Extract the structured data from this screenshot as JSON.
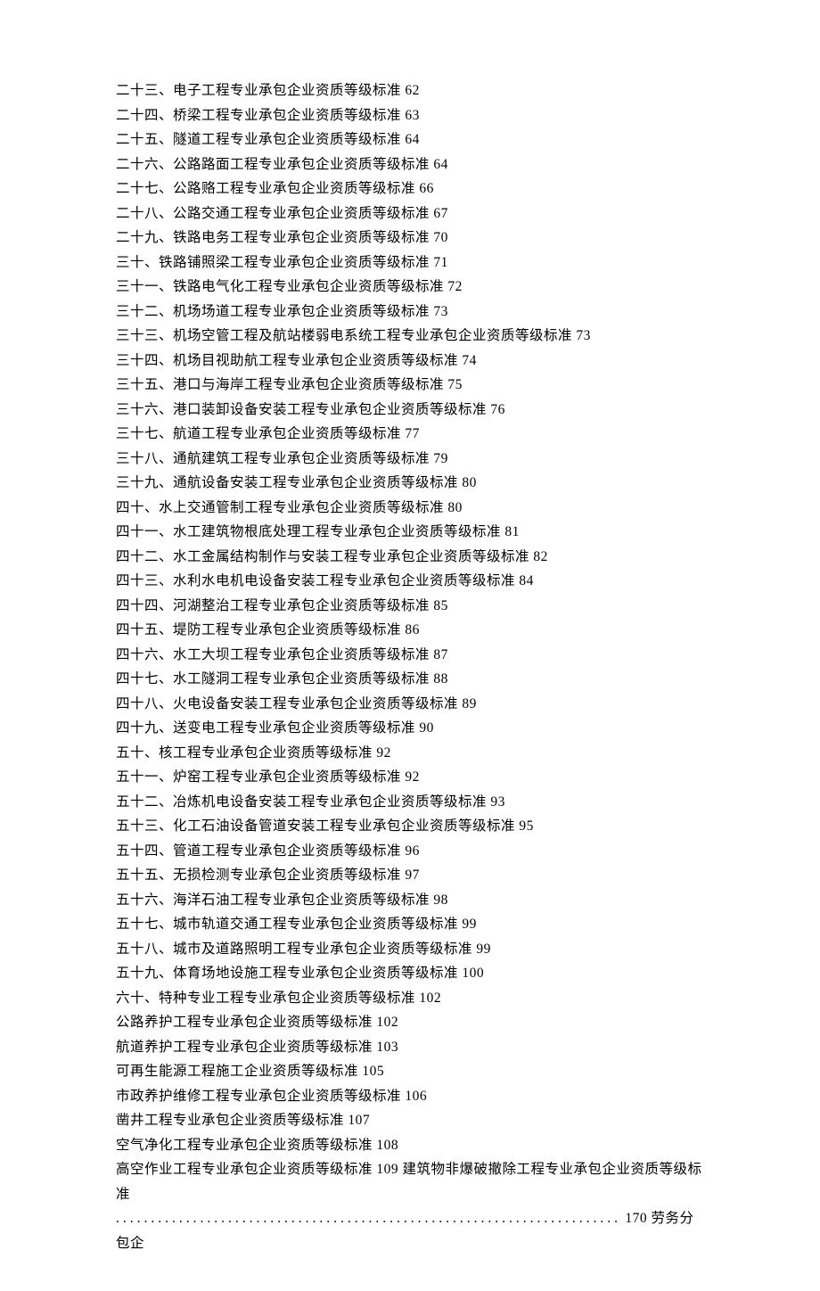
{
  "toc_lines": [
    "二十三、电子工程专业承包企业资质等级标准 62",
    "二十四、桥梁工程专业承包企业资质等级标准 63",
    "二十五、隧道工程专业承包企业资质等级标准 64",
    "二十六、公路路面工程专业承包企业资质等级标准 64",
    "二十七、公路赂工程专业承包企业资质等级标准 66",
    "二十八、公路交通工程专业承包企业资质等级标准 67",
    "二十九、铁路电务工程专业承包企业资质等级标准 70",
    "三十、铁路铺照梁工程专业承包企业资质等级标准 71",
    "三十一、铁路电气化工程专业承包企业资质等级标准 72",
    "三十二、机场场道工程专业承包企业资质等级标准 73",
    "三十三、机场空管工程及航站楼弱电系统工程专业承包企业资质等级标准 73",
    "三十四、机场目视助航工程专业承包企业资质等级标准 74",
    "三十五、港口与海岸工程专业承包企业资质等级标准 75",
    "三十六、港口装卸设备安装工程专业承包企业资质等级标准 76",
    "三十七、航道工程专业承包企业资质等级标准 77",
    "三十八、通航建筑工程专业承包企业资质等级标准 79",
    "三十九、通航设备安装工程专业承包企业资质等级标准 80",
    "四十、水上交通管制工程专业承包企业资质等级标准 80",
    "四十一、水工建筑物根底处理工程专业承包企业资质等级标准 81",
    "四十二、水工金属结构制作与安装工程专业承包企业资质等级标准 82",
    "四十三、水利水电机电设备安装工程专业承包企业资质等级标准 84",
    "四十四、河湖整治工程专业承包企业资质等级标准 85",
    "四十五、堤防工程专业承包企业资质等级标准 86",
    "四十六、水工大坝工程专业承包企业资质等级标准 87",
    "四十七、水工隧洞工程专业承包企业资质等级标准 88",
    "四十八、火电设备安装工程专业承包企业资质等级标准 89",
    "四十九、送变电工程专业承包企业资质等级标准 90",
    "五十、核工程专业承包企业资质等级标准 92",
    "五十一、炉窑工程专业承包企业资质等级标准 92",
    "五十二、冶炼机电设备安装工程专业承包企业资质等级标准 93",
    "五十三、化工石油设备管道安装工程专业承包企业资质等级标准 95",
    "五十四、管道工程专业承包企业资质等级标准 96",
    "五十五、无损检测专业承包企业资质等级标准 97",
    "五十六、海洋石油工程专业承包企业资质等级标准 98",
    "五十七、城市轨道交通工程专业承包企业资质等级标准 99",
    "五十八、城市及道路照明工程专业承包企业资质等级标准 99",
    "五十九、体育场地设施工程专业承包企业资质等级标准 100",
    "六十、特种专业工程专业承包企业资质等级标准 102",
    "公路养护工程专业承包企业资质等级标准 102",
    "航道养护工程专业承包企业资质等级标准 103",
    "可再生能源工程施工企业资质等级标准 105",
    "市政养护维修工程专业承包企业资质等级标准 106",
    "凿井工程专业承包企业资质等级标准 107",
    "空气净化工程专业承包企业资质等级标准 108",
    "高空作业工程专业承包企业资质等级标准 109 建筑物非爆破撤除工程专业承包企业资质等级标准"
  ],
  "dots_line": "........................................................................",
  "trailing_text": " 170 劳务分包企"
}
